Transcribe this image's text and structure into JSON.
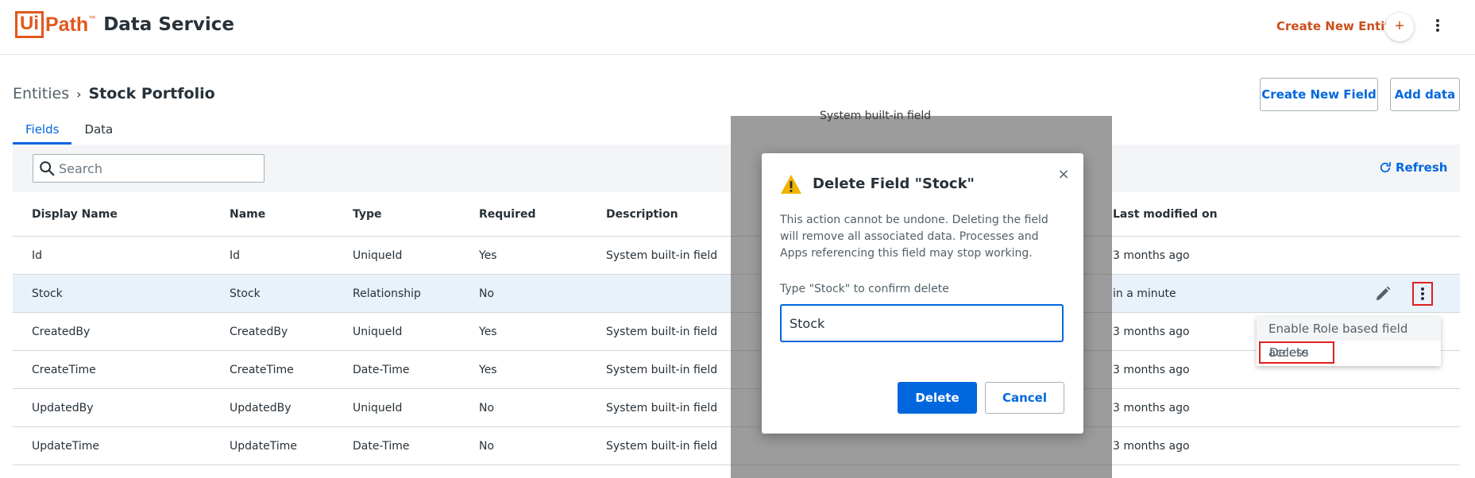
{
  "header": {
    "logo_ui": "Ui",
    "logo_path": "Path",
    "logo_tm": "™",
    "product": "Data Service",
    "create_entity_label": "Create New Entity",
    "plus_glyph": "+"
  },
  "breadcrumb": {
    "root": "Entities",
    "separator": "›",
    "current": "Stock Portfolio"
  },
  "actions": {
    "create_field": "Create New Field",
    "add_data": "Add data"
  },
  "tabs": [
    {
      "label": "Fields",
      "active": true
    },
    {
      "label": "Data",
      "active": false
    }
  ],
  "toolbar": {
    "search_placeholder": "Search",
    "refresh_label": "Refresh"
  },
  "table": {
    "columns": [
      "Display Name",
      "Name",
      "Type",
      "Required",
      "Description",
      "Last modified on"
    ],
    "rows": [
      {
        "display_name": "Id",
        "name": "Id",
        "type": "UniqueId",
        "required": "Yes",
        "description": "System built-in field",
        "modified": "3 months ago"
      },
      {
        "display_name": "Stock",
        "name": "Stock",
        "type": "Relationship",
        "required": "No",
        "description": "",
        "modified": "in a minute"
      },
      {
        "display_name": "CreatedBy",
        "name": "CreatedBy",
        "type": "UniqueId",
        "required": "Yes",
        "description": "System built-in field",
        "modified": "3 months ago"
      },
      {
        "display_name": "CreateTime",
        "name": "CreateTime",
        "type": "Date-Time",
        "required": "Yes",
        "description": "System built-in field",
        "modified": "3 months ago"
      },
      {
        "display_name": "UpdatedBy",
        "name": "UpdatedBy",
        "type": "UniqueId",
        "required": "No",
        "description": "System built-in field",
        "modified": "3 months ago"
      },
      {
        "display_name": "UpdateTime",
        "name": "UpdateTime",
        "type": "Date-Time",
        "required": "No",
        "description": "System built-in field",
        "modified": "3 months ago"
      }
    ]
  },
  "row_menu": {
    "items": [
      "Enable Role based field access",
      "Delete"
    ]
  },
  "overlay": {
    "peek_text": "System built-in field"
  },
  "dialog": {
    "title": "Delete Field \"Stock\"",
    "close_glyph": "×",
    "body": "This action cannot be undone. Deleting the field will remove all associated data. Processes and Apps referencing this field may stop working.",
    "confirm_label": "Type \"Stock\" to confirm delete",
    "input_value": "Stock",
    "delete_label": "Delete",
    "cancel_label": "Cancel"
  },
  "colors": {
    "brand_orange": "#e2581c",
    "accent_blue": "#0067df",
    "highlight_red": "#e0201e",
    "warning_yellow": "#f2b300"
  },
  "icons": [
    "search-icon",
    "refresh-icon",
    "edit-icon",
    "more-vert-icon",
    "warning-icon",
    "close-icon",
    "chevron-right-icon",
    "plus-icon"
  ]
}
